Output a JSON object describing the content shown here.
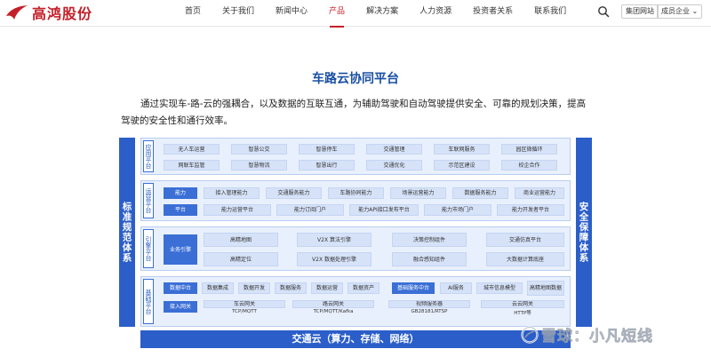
{
  "header": {
    "logo_text": "高鸿股份",
    "nav": [
      "首页",
      "关于我们",
      "新闻中心",
      "产品",
      "解决方案",
      "人力资源",
      "投资者关系",
      "联系我们"
    ],
    "active_nav": "产品",
    "group_site": "集团网站",
    "member_company": "成员企业",
    "brand_color": "#c3202a"
  },
  "main": {
    "title": "车路云协同平台",
    "intro": "通过实现车-路-云的强耦合，以及数据的互联互通，为辅助驾驶和自动驾驶提供安全、可靠的规划决策，提高驾驶的安全性和通行效率。"
  },
  "diagram": {
    "left_column": "标准规范体系",
    "right_column": "安全保障体系",
    "bottom_bar": "交通云（算力、存储、网络）",
    "accent_color": "#2b5ec9",
    "app_layer": {
      "label": "应用平台",
      "row1": [
        "无人车运营",
        "智慧公交",
        "智慧停车",
        "交通管理",
        "车联网服务",
        "园区微循环"
      ],
      "row2": [
        "网联车监管",
        "智慧物流",
        "智慧出行",
        "交通优化",
        "示范区建设",
        "校企合作"
      ]
    },
    "ops_layer": {
      "label": "运营平台",
      "tag1": "能力",
      "row1": [
        "接入管理能力",
        "交通服务能力",
        "车路协同能力",
        "场景运营能力",
        "数据服务能力",
        "商业运营能力"
      ],
      "tag2": "平台",
      "row2": [
        "能力运营平台",
        "能力订阅门户",
        "能力API接口发布平台",
        "能力市场门户",
        "能力开发者平台"
      ]
    },
    "engine_layer": {
      "label": "引擎平台",
      "tag": "业务引擎",
      "row1": [
        "高精地图",
        "V2X 算法引擎",
        "决策控制组件",
        "交通仿真平台"
      ],
      "row2": [
        "高精定位",
        "V2X 数据处理引擎",
        "融合感知组件",
        "大数据计算底座"
      ]
    },
    "base_layer": {
      "label": "基础平台",
      "data_tag": "数据中台",
      "data_items": [
        "数据集成",
        "数据开发",
        "数据服务",
        "数据运营",
        "数据资产"
      ],
      "service_tag": "基础服务中台",
      "service_items": [
        "AI服务",
        "城市信息模型",
        "高精地图数据"
      ],
      "access_tag": "接入网关",
      "gateways": [
        {
          "name": "车云网关",
          "protocol": "TCP/MQTT"
        },
        {
          "name": "路云网关",
          "protocol": "TCP/MQTT/Kafka"
        },
        {
          "name": "视频服务器",
          "protocol": "GB28181/RTSP"
        },
        {
          "name": "云云网关",
          "protocol": "HTTP等"
        }
      ]
    }
  },
  "watermark": "雪球：小凡短线"
}
